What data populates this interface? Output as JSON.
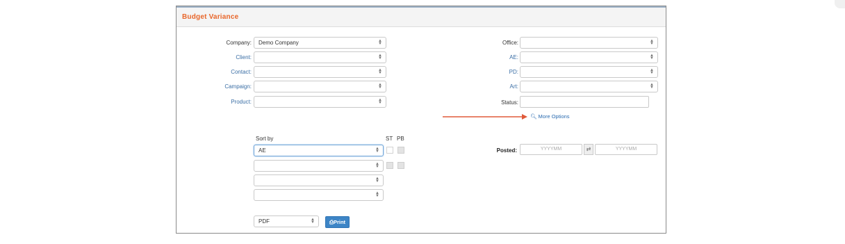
{
  "panel": {
    "title": "Budget Variance"
  },
  "left_fields": [
    {
      "label": "Company:",
      "value": "Demo Company",
      "style": "dark"
    },
    {
      "label": "Client:",
      "value": "",
      "style": "link"
    },
    {
      "label": "Contact:",
      "value": "",
      "style": "link"
    },
    {
      "label": "Campaign:",
      "value": "",
      "style": "link"
    },
    {
      "label": "Product:",
      "value": "",
      "style": "link"
    }
  ],
  "right_fields": [
    {
      "label": "Office:",
      "value": "",
      "style": "dark"
    },
    {
      "label": "AE:",
      "value": "",
      "style": "link"
    },
    {
      "label": "PD:",
      "value": "",
      "style": "link"
    },
    {
      "label": "Art:",
      "value": "",
      "style": "link"
    },
    {
      "label": "Status:",
      "value": "",
      "style": "dark"
    }
  ],
  "more_options": "More Options",
  "sort": {
    "label": "Sort by",
    "col_st": "ST",
    "col_pb": "PB",
    "rows": [
      "AE",
      "",
      "",
      ""
    ]
  },
  "posted": {
    "label": "Posted:",
    "from_placeholder": "YYYYMM",
    "to_placeholder": "YYYYMM",
    "swap_symbol": "⇄"
  },
  "output": {
    "format": "PDF",
    "print_label": "Print"
  },
  "colors": {
    "title": "#e8662a",
    "link": "#3a6ea5",
    "button": "#3d85c6",
    "arrow": "#e05a3a"
  }
}
